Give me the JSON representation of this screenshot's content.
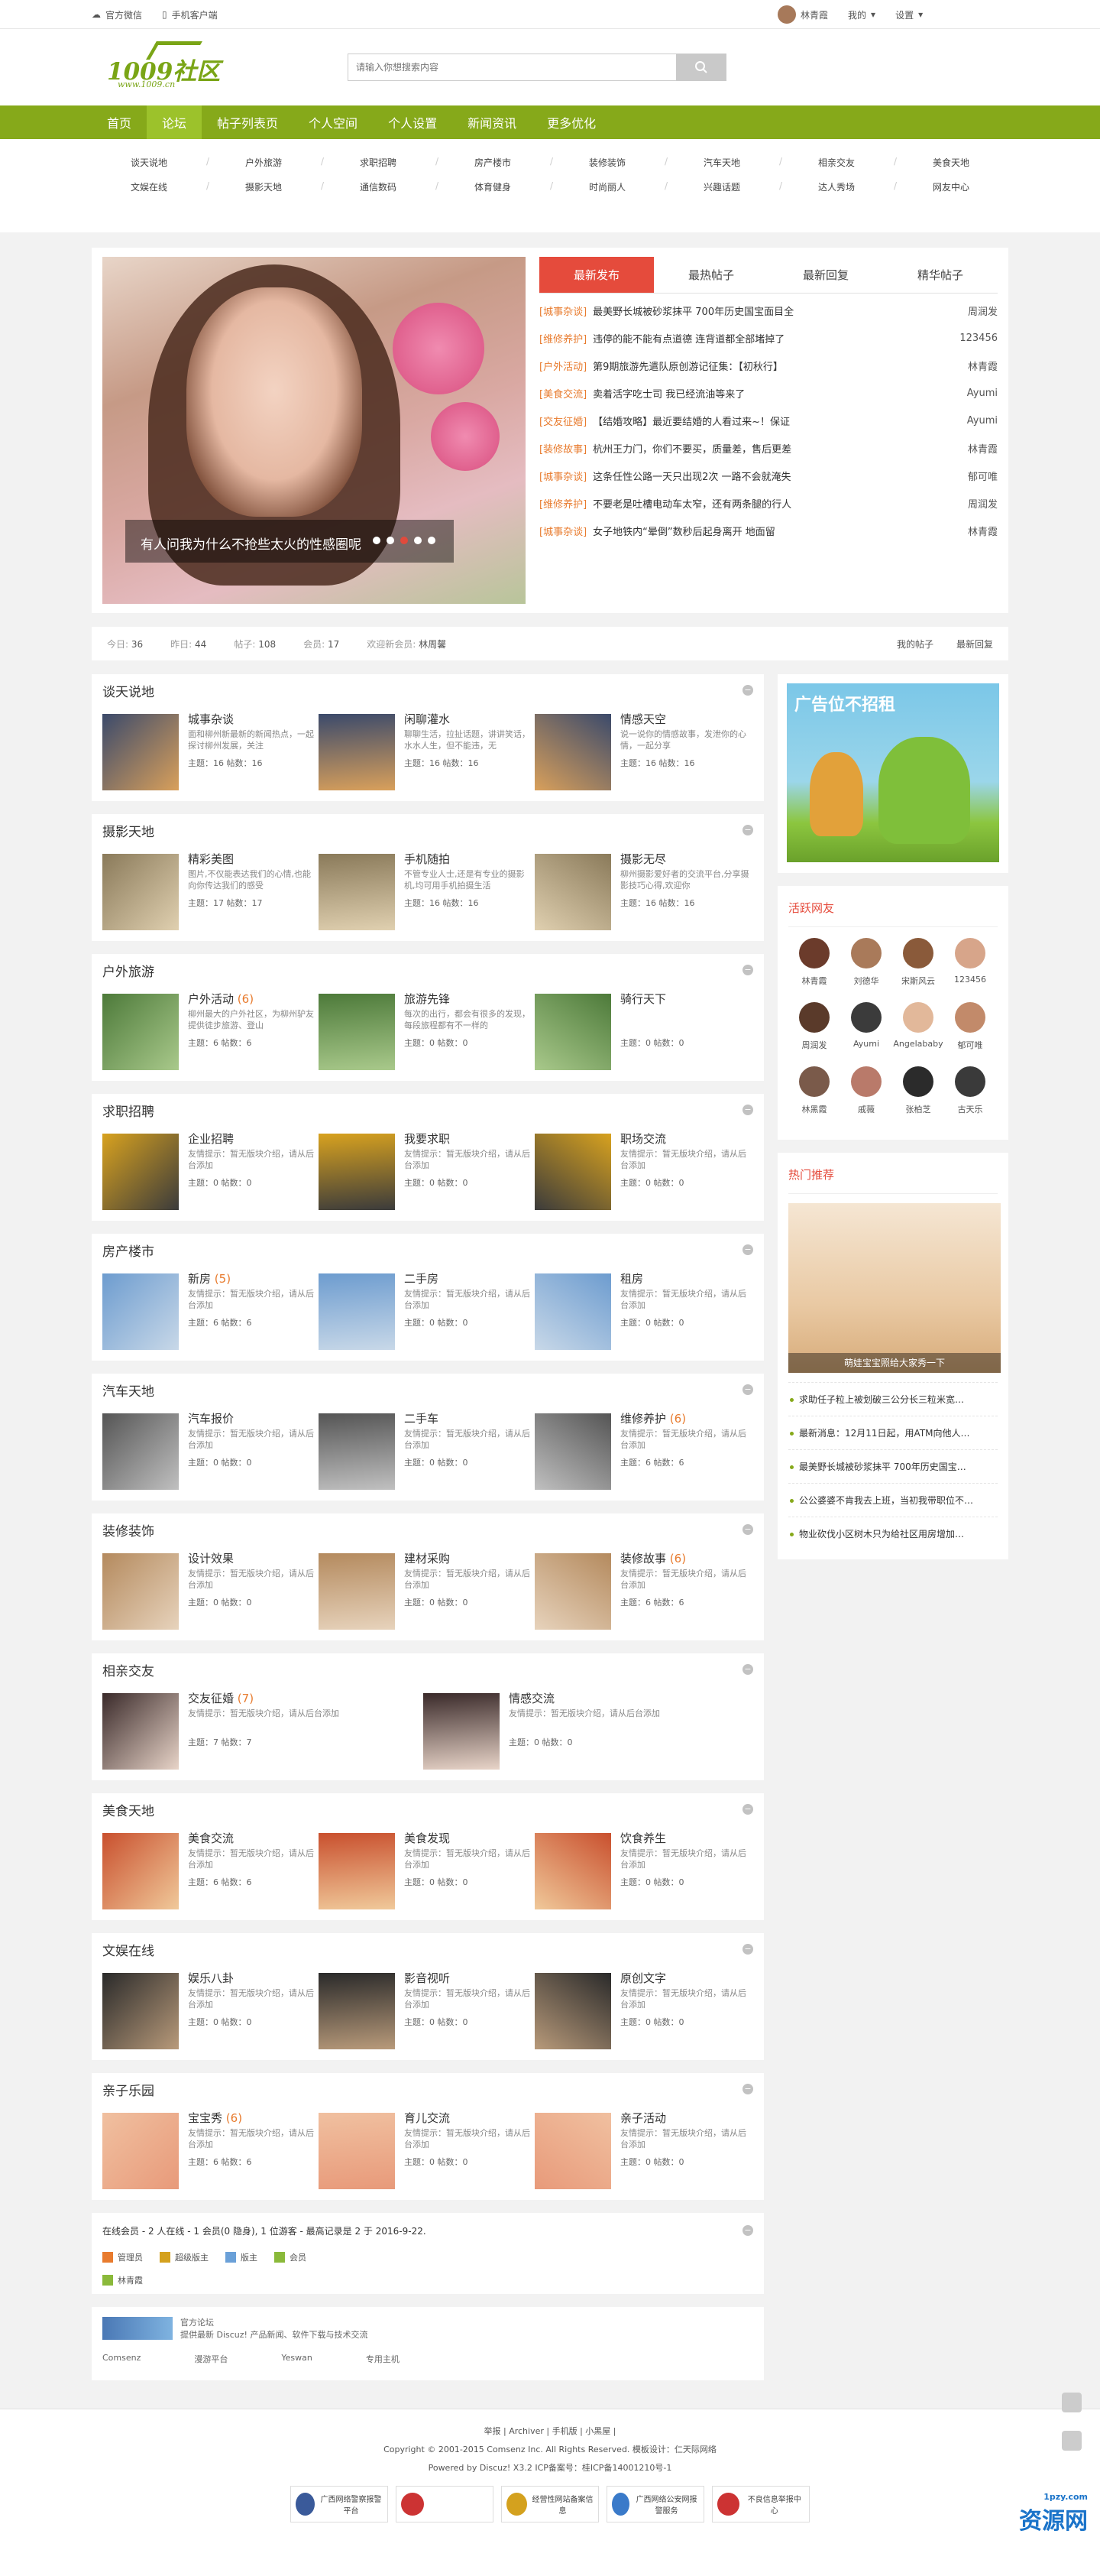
{
  "topbar": {
    "weixin": "官方微信",
    "mobile": "手机客户端",
    "user": "林青霞",
    "my": "我的",
    "settings": "设置"
  },
  "search": {
    "placeholder": "请输入你想搜索内容"
  },
  "logo": {
    "main": "1009社区",
    "sub": "www.1009.cn"
  },
  "nav": [
    "首页",
    "论坛",
    "帖子列表页",
    "个人空间",
    "个人设置",
    "新闻资讯",
    "更多优化"
  ],
  "subnav": [
    [
      "谈天说地",
      "户外旅游",
      "求职招聘",
      "房产楼市",
      "装修装饰",
      "汽车天地",
      "相亲交友",
      "美食天地"
    ],
    [
      "文娱在线",
      "摄影天地",
      "通信数码",
      "体育健身",
      "时尚丽人",
      "兴趣话题",
      "达人秀场",
      "网友中心"
    ]
  ],
  "slide": {
    "caption": "有人问我为什么不抢些太火的性感圈呢"
  },
  "hot": {
    "tabs": [
      "最新发布",
      "最热帖子",
      "最新回复",
      "精华帖子"
    ],
    "items": [
      {
        "c": "[城事杂谈]",
        "t": "最美野长城被砂浆抹平 700年历史国宝面目全",
        "a": "周润发"
      },
      {
        "c": "[维修养护]",
        "t": "违停的能不能有点道德 连背道都全部堵掉了",
        "a": "123456"
      },
      {
        "c": "[户外活动]",
        "t": "第9期旅游先遣队原创游记征集：【初秋行】",
        "a": "林青霞"
      },
      {
        "c": "[美食交流]",
        "t": "卖着活字吃士司 我已经流油等来了",
        "a": "Ayumi"
      },
      {
        "c": "[交友征婚]",
        "t": "【结婚攻略】最近要结婚的人看过来~！保证",
        "a": "Ayumi"
      },
      {
        "c": "[装修故事]",
        "t": "杭州王力门，你们不要买，质量差，售后更差",
        "a": "林青霞"
      },
      {
        "c": "[城事杂谈]",
        "t": "这条任性公路一天只出现2次 一路不会就淹失",
        "a": "郁可唯"
      },
      {
        "c": "[维修养护]",
        "t": "不要老是吐槽电动车太窄，还有两条腿的行人",
        "a": "周润发"
      },
      {
        "c": "[城事杂谈]",
        "t": "女子地铁内“晕倒”数秒后起身离开 地面留",
        "a": "林青霞"
      }
    ]
  },
  "stats": {
    "today_l": "今日:",
    "today": "36",
    "yest_l": "昨日:",
    "yest": "44",
    "posts_l": "帖子:",
    "posts": "108",
    "members_l": "会员:",
    "members": "17",
    "welcome": "欢迎新会员:",
    "newuser": "林周馨",
    "mine": "我的帖子",
    "latest": "最新回复"
  },
  "sections": [
    {
      "title": "谈天说地",
      "forums": [
        {
          "name": "城事杂谈",
          "new": "",
          "desc": "面和柳州新最新的新闻热点，一起探讨柳州发展，关注",
          "stats": "主题：16  帖数：16"
        },
        {
          "name": "闲聊灌水",
          "new": "",
          "desc": "聊聊生活，拉扯话题，讲讲笑话，水水人生，但不能违，无",
          "stats": "主题：16  帖数：16"
        },
        {
          "name": "情感天空",
          "new": "",
          "desc": "说一说你的情感故事，发泄你的心情，一起分享",
          "stats": "主题：16  帖数：16"
        }
      ]
    },
    {
      "title": "摄影天地",
      "forums": [
        {
          "name": "精彩美图",
          "new": "",
          "desc": "图片,不仅能表达我们的心情,也能向你传达我们的感受",
          "stats": "主题：17  帖数：17"
        },
        {
          "name": "手机随拍",
          "new": "",
          "desc": "不管专业人士,还是有专业的摄影机,均可用手机拍摄生活",
          "stats": "主题：16  帖数：16"
        },
        {
          "name": "摄影无尽",
          "new": "",
          "desc": "柳州摄影爱好者的交流平台,分享摄影技巧心得,欢迎你",
          "stats": "主题：16  帖数：16"
        }
      ]
    },
    {
      "title": "户外旅游",
      "forums": [
        {
          "name": "户外活动",
          "new": "(6)",
          "desc": "柳州最大的户外社区，为柳州驴友提供徒步旅游、登山",
          "stats": "主题：6  帖数：6"
        },
        {
          "name": "旅游先锋",
          "new": "",
          "desc": "每次的出行，都会有很多的发现，每段旅程都有不一样的",
          "stats": "主题：0  帖数：0"
        },
        {
          "name": "骑行天下",
          "new": "",
          "desc": "",
          "stats": "主题：0  帖数：0"
        }
      ]
    },
    {
      "title": "求职招聘",
      "forums": [
        {
          "name": "企业招聘",
          "new": "",
          "desc": "友情提示：暂无版块介绍，请从后台添加",
          "stats": "主题：0  帖数：0"
        },
        {
          "name": "我要求职",
          "new": "",
          "desc": "友情提示：暂无版块介绍，请从后台添加",
          "stats": "主题：0  帖数：0"
        },
        {
          "name": "职场交流",
          "new": "",
          "desc": "友情提示：暂无版块介绍，请从后台添加",
          "stats": "主题：0  帖数：0"
        }
      ]
    },
    {
      "title": "房产楼市",
      "forums": [
        {
          "name": "新房",
          "new": "(5)",
          "desc": "友情提示：暂无版块介绍，请从后台添加",
          "stats": "主题：6  帖数：6"
        },
        {
          "name": "二手房",
          "new": "",
          "desc": "友情提示：暂无版块介绍，请从后台添加",
          "stats": "主题：0  帖数：0"
        },
        {
          "name": "租房",
          "new": "",
          "desc": "友情提示：暂无版块介绍，请从后台添加",
          "stats": "主题：0  帖数：0"
        }
      ]
    },
    {
      "title": "汽车天地",
      "forums": [
        {
          "name": "汽车报价",
          "new": "",
          "desc": "友情提示：暂无版块介绍，请从后台添加",
          "stats": "主题：0  帖数：0"
        },
        {
          "name": "二手车",
          "new": "",
          "desc": "友情提示：暂无版块介绍，请从后台添加",
          "stats": "主题：0  帖数：0"
        },
        {
          "name": "维修养护",
          "new": "(6)",
          "desc": "友情提示：暂无版块介绍，请从后台添加",
          "stats": "主题：6  帖数：6"
        }
      ]
    },
    {
      "title": "装修装饰",
      "forums": [
        {
          "name": "设计效果",
          "new": "",
          "desc": "友情提示：暂无版块介绍，请从后台添加",
          "stats": "主题：0  帖数：0"
        },
        {
          "name": "建材采购",
          "new": "",
          "desc": "友情提示：暂无版块介绍，请从后台添加",
          "stats": "主题：0  帖数：0"
        },
        {
          "name": "装修故事",
          "new": "(6)",
          "desc": "友情提示：暂无版块介绍，请从后台添加",
          "stats": "主题：6  帖数：6"
        }
      ]
    },
    {
      "title": "相亲交友",
      "forums": [
        {
          "name": "交友征婚",
          "new": "(7)",
          "desc": "友情提示：暂无版块介绍，请从后台添加",
          "stats": "主题：7  帖数：7"
        },
        {
          "name": "情感交流",
          "new": "",
          "desc": "友情提示：暂无版块介绍，请从后台添加",
          "stats": "主题：0  帖数：0"
        }
      ]
    },
    {
      "title": "美食天地",
      "forums": [
        {
          "name": "美食交流",
          "new": "",
          "desc": "友情提示：暂无版块介绍，请从后台添加",
          "stats": "主题：6  帖数：6"
        },
        {
          "name": "美食发现",
          "new": "",
          "desc": "友情提示：暂无版块介绍，请从后台添加",
          "stats": "主题：0  帖数：0"
        },
        {
          "name": "饮食养生",
          "new": "",
          "desc": "友情提示：暂无版块介绍，请从后台添加",
          "stats": "主题：0  帖数：0"
        }
      ]
    },
    {
      "title": "文娱在线",
      "forums": [
        {
          "name": "娱乐八卦",
          "new": "",
          "desc": "友情提示：暂无版块介绍，请从后台添加",
          "stats": "主题：0  帖数：0"
        },
        {
          "name": "影音视听",
          "new": "",
          "desc": "友情提示：暂无版块介绍，请从后台添加",
          "stats": "主题：0  帖数：0"
        },
        {
          "name": "原创文字",
          "new": "",
          "desc": "友情提示：暂无版块介绍，请从后台添加",
          "stats": "主题：0  帖数：0"
        }
      ]
    },
    {
      "title": "亲子乐园",
      "forums": [
        {
          "name": "宝宝秀",
          "new": "(6)",
          "desc": "友情提示：暂无版块介绍，请从后台添加",
          "stats": "主题：6  帖数：6"
        },
        {
          "name": "育儿交流",
          "new": "",
          "desc": "友情提示：暂无版块介绍，请从后台添加",
          "stats": "主题：0  帖数：0"
        },
        {
          "name": "亲子活动",
          "new": "",
          "desc": "友情提示：暂无版块介绍，请从后台添加",
          "stats": "主题：0  帖数：0"
        }
      ]
    }
  ],
  "online": {
    "text": "在线会员 - 2 人在线 - 1 会员(0 隐身), 1 位游客 - 最高记录是 2 于 2016-9-22.",
    "roles": [
      "管理员",
      "超级版主",
      "版主",
      "会员"
    ],
    "user": "林青霞"
  },
  "links": {
    "title": "官方论坛",
    "desc": "提供最新 Discuz! 产品新闻、软件下载与技术交流",
    "items": [
      "Comsenz",
      "漫游平台",
      "Yeswan",
      "专用主机"
    ]
  },
  "ad": {
    "text": "广告位不招租"
  },
  "active": {
    "title": "活跃网友",
    "users": [
      "林青霞",
      "刘德华",
      "宋斯风云",
      "123456",
      "周润发",
      "Ayumi",
      "Angelababy",
      "郁可唯",
      "林黑霞",
      "戚薇",
      "张柏芝",
      "古天乐"
    ]
  },
  "recommend": {
    "title": "热门推荐",
    "caption": "萌娃宝宝照给大家秀一下",
    "items": [
      "求助任子粒上被划破三公分长三粒米宽…",
      "最新消息：12月11日起，用ATM向他人…",
      "最美野长城被砂浆抹平 700年历史国宝…",
      "公公婆婆不肯我去上班，当初我带职位不…",
      "物业砍伐小区树木只为给社区用房增加…"
    ]
  },
  "footer": {
    "links": "举报 | Archiver | 手机版 | 小黑屋 |",
    "copyright": "Copyright © 2001-2015 Comsenz Inc. All Rights Reserved.  模板设计：仁天际网络",
    "powered": "Powered by Discuz! X3.2  ICP备案号：桂ICP备14001210号-1",
    "badges": [
      "广西网络警察报警平台",
      "",
      "经营性网站备案信息",
      "广西网络公安网报警服务",
      "不良信息举报中心"
    ]
  },
  "watermark": {
    "main": "资源网",
    "sub": "1pzy.com"
  }
}
